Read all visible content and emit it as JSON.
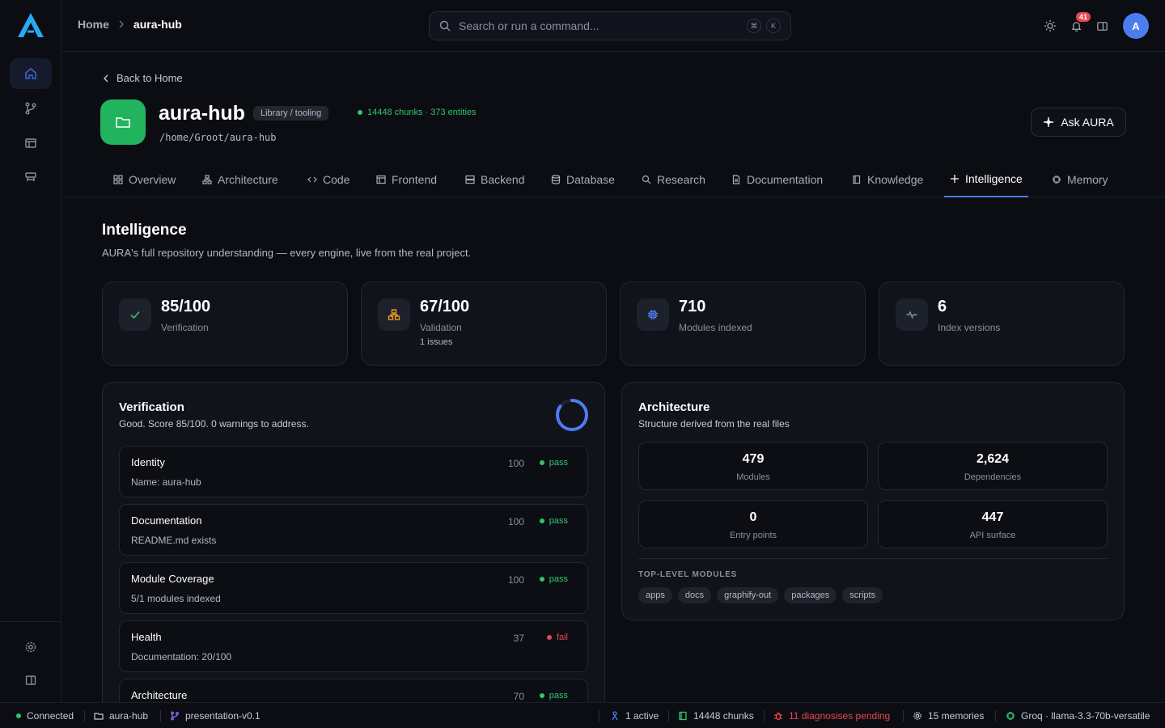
{
  "topbar": {
    "breadcrumb_home": "Home",
    "breadcrumb_current": "aura-hub",
    "search_placeholder": "Search or run a command...",
    "shortcut_keys": [
      "⌘",
      "K"
    ],
    "notification_count": "41",
    "avatar_initial": "A"
  },
  "header": {
    "back_label": "Back to Home",
    "project_name": "aura-hub",
    "project_type": "Library / tooling",
    "project_stats": "14448 chunks · 373 entities",
    "project_path": "/home/Groot/aura-hub",
    "ask_button": "Ask AURA"
  },
  "tabs": [
    {
      "label": "Overview",
      "icon": "grid-icon"
    },
    {
      "label": "Architecture",
      "icon": "hierarchy-icon"
    },
    {
      "label": "Code",
      "icon": "code-icon"
    },
    {
      "label": "Frontend",
      "icon": "layout-icon"
    },
    {
      "label": "Backend",
      "icon": "server-icon"
    },
    {
      "label": "Database",
      "icon": "database-icon"
    },
    {
      "label": "Research",
      "icon": "search-icon"
    },
    {
      "label": "Documentation",
      "icon": "document-icon"
    },
    {
      "label": "Knowledge",
      "icon": "book-icon"
    },
    {
      "label": "Intelligence",
      "icon": "sparkle-icon",
      "active": true
    },
    {
      "label": "Memory",
      "icon": "chip-icon"
    }
  ],
  "section": {
    "title": "Intelligence",
    "subtitle": "AURA's full repository understanding — every engine, live from the real project."
  },
  "stats": [
    {
      "value": "85/100",
      "label": "Verification",
      "extra": "",
      "icon": "check-icon",
      "color": "#34c46d"
    },
    {
      "value": "67/100",
      "label": "Validation",
      "extra": "1 issues",
      "icon": "hierarchy-icon",
      "color": "#f0a020"
    },
    {
      "value": "710",
      "label": "Modules indexed",
      "extra": "",
      "icon": "chip-icon",
      "color": "#4d7cf0"
    },
    {
      "value": "6",
      "label": "Index versions",
      "extra": "",
      "icon": "activity-icon",
      "color": "#8a8f9c"
    }
  ],
  "verification": {
    "title": "Verification",
    "summary": "Good. Score 85/100. 0 warnings to address.",
    "score": 85,
    "checks": [
      {
        "name": "Identity",
        "detail": "Name: aura-hub",
        "score": "100",
        "status": "pass"
      },
      {
        "name": "Documentation",
        "detail": "README.md exists",
        "score": "100",
        "status": "pass"
      },
      {
        "name": "Module Coverage",
        "detail": "5/1 modules indexed",
        "score": "100",
        "status": "pass"
      },
      {
        "name": "Health",
        "detail": "Documentation: 20/100",
        "score": "37",
        "status": "fail"
      },
      {
        "name": "Architecture",
        "detail": "",
        "score": "70",
        "status": "pass"
      }
    ]
  },
  "architecture": {
    "title": "Architecture",
    "subtitle": "Structure derived from the real files",
    "metrics": [
      {
        "value": "479",
        "label": "Modules"
      },
      {
        "value": "2,624",
        "label": "Dependencies"
      },
      {
        "value": "0",
        "label": "Entry points"
      },
      {
        "value": "447",
        "label": "API surface"
      }
    ],
    "modules_heading": "TOP-LEVEL MODULES",
    "modules": [
      "apps",
      "docs",
      "graphify-out",
      "packages",
      "scripts"
    ]
  },
  "statusbar": {
    "connection": "Connected",
    "project": "aura-hub",
    "branch": "presentation-v0.1",
    "active": "1 active",
    "chunks": "14448 chunks",
    "diagnoses": "11 diagnosises pending",
    "memories": "15 memories",
    "model": "Groq · llama-3.3-70b-versatile"
  },
  "colors": {
    "accent": "#4d7cf0",
    "pass": "#34c46d",
    "fail": "#e5484d",
    "project_icon": "#22b35e"
  }
}
